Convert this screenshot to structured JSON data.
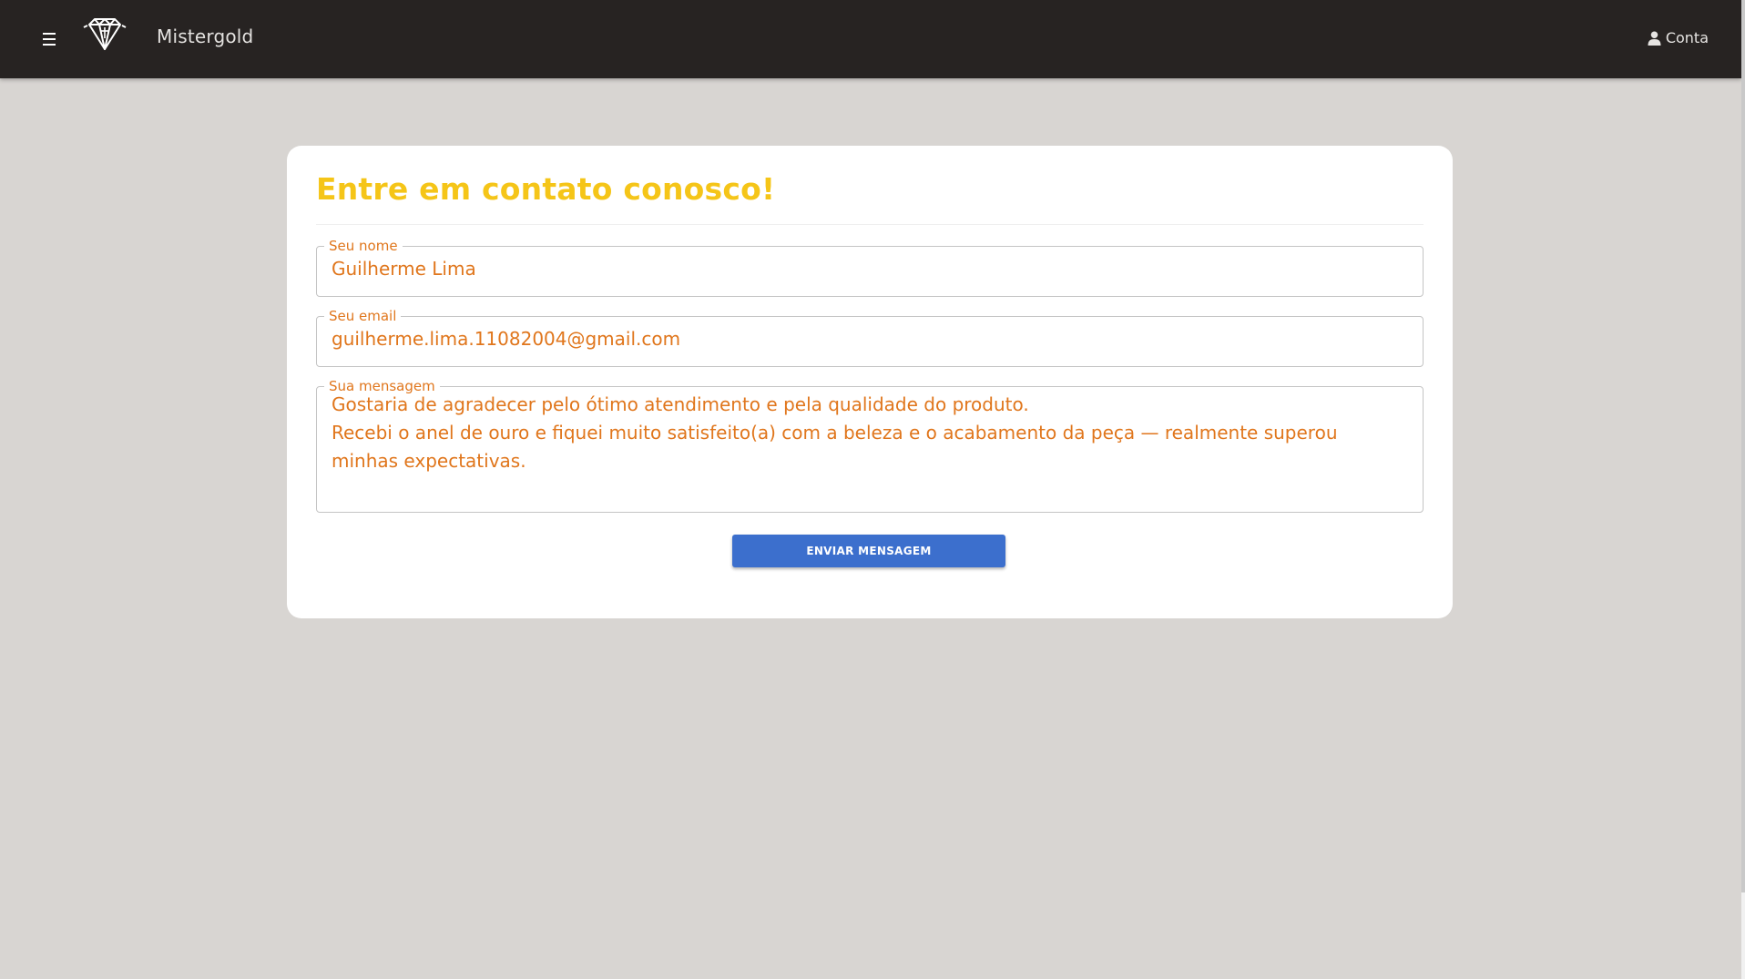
{
  "header": {
    "brand": "Mistergold",
    "account_label": "Conta",
    "menu_icon": "hamburger-menu-icon",
    "logo_icon": "diamond-logo-icon",
    "account_icon": "user-icon"
  },
  "contact_form": {
    "title": "Entre em contato conosco!",
    "name_label": "Seu nome",
    "name_value": "Guilherme Lima",
    "email_label": "Seu email",
    "email_value": "guilherme.lima.11082004@gmail.com",
    "message_label": "Sua mensagem",
    "message_lines": [
      "Gostaria de agradecer pelo ótimo atendimento e pela qualidade do produto.",
      "Recebi o anel de ouro e fiquei muito satisfeito(a) com a beleza e o acabamento da peça — realmente superou minhas expectativas."
    ],
    "submit_label": "ENVIAR MENSAGEM"
  },
  "colors": {
    "topbar": "#272322",
    "background": "#d8d5d2",
    "title_gold": "#f5c518",
    "field_text_orange": "#e0761c",
    "button_blue": "#3c6fcd"
  }
}
